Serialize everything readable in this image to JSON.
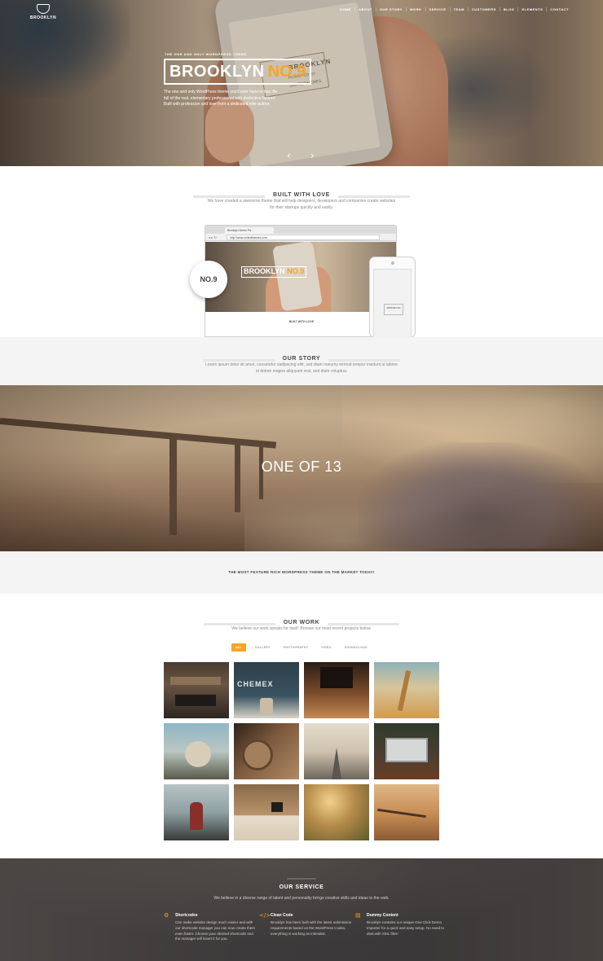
{
  "brand": {
    "name": "BROOKLYN"
  },
  "nav": {
    "items": [
      "HOME",
      "ABOUT",
      "OUR STORY",
      "WORK",
      "SERVICE",
      "TEAM",
      "CUSTOMERS",
      "BLOG",
      "ELEMENTS",
      "CONTACT"
    ]
  },
  "hero": {
    "kicker": "THE ONE AND ONLY WORDPRESS THEME",
    "title_a": "BROOKLYN",
    "title_b": "NO.9",
    "description": "The one and only WordPress theme you'll ever have to buy. Be full of the real, elementary professional with distinctive factors! Built with profession and love from a dedicated elite author.",
    "phone_brand": "BROOKLYN",
    "phone_powered": "POWERED BY",
    "phone_company": "UNITEDTHEMES",
    "prev_arrow": "‹",
    "next_arrow": "›"
  },
  "built": {
    "title": "BUILT WITH LOVE",
    "subtitle": "We have created a awesome theme that will help designers, developers and companies create websites for their startups quickly and easily.",
    "badge": "NO.9",
    "browser_tab": "Brooklyn Demo Pa...",
    "browser_url": "http://www.unitedthemes.com",
    "browser_title_a": "BROOKLYN",
    "browser_title_b": "NO.9",
    "browser_section": "BUILT WITH LOVE",
    "mobile_brand": "BROOKLYN"
  },
  "story": {
    "title": "OUR STORY",
    "subtitle": "Lorem ipsum dolor sit amet, consetetur sadipscing elitr, sed diam nonumy eirmod tempor invidunt ut labore et dolore magna aliquyam erat, sed diam voluptua."
  },
  "scene": {
    "title": "ONE OF 13"
  },
  "feature": {
    "text": "THE MOST FEATURE RICH WORDPRESS THEME ON THE MARKET TODAY!"
  },
  "work": {
    "title": "OUR WORK",
    "subtitle": "We believe our work speaks for itself. Browse our most recent projects below.",
    "filters": [
      "ALL",
      "GALLERY",
      "PHOTOGRAPHY",
      "VIDEO",
      "SOUNDCLOUD"
    ],
    "tiles": [
      {
        "name": "cafe-interior",
        "label": ""
      },
      {
        "name": "chemex-coffee",
        "label": "CHEMEX"
      },
      {
        "name": "wooden-floor",
        "label": ""
      },
      {
        "name": "wheat-field",
        "label": ""
      },
      {
        "name": "dog-on-bridge",
        "label": ""
      },
      {
        "name": "wood-logs",
        "label": ""
      },
      {
        "name": "misty-road",
        "label": ""
      },
      {
        "name": "laptop-desk",
        "label": ""
      },
      {
        "name": "hiker-waterfall",
        "label": ""
      },
      {
        "name": "camera-table",
        "label": ""
      },
      {
        "name": "sunset-grass",
        "label": ""
      },
      {
        "name": "fence-field",
        "label": ""
      }
    ]
  },
  "service": {
    "title": "OUR SERVICE",
    "subtitle": "We believe in a diverse range of talent and personality brings creative skills and ideas to the web.",
    "columns": [
      {
        "icon": "gear-icon",
        "glyph": "⚙",
        "heading": "Shortcodes",
        "text": "Can make website design much easier and with our shortcode manager you can now create them even faster. Choose your desired shortcode and the manager will insert it for you."
      },
      {
        "icon": "code-icon",
        "glyph": "</>",
        "heading": "Clean Code",
        "text": "Brooklyn has been built with the latest submission requirements based on the WordPress Codex, everything is working as intended."
      },
      {
        "icon": "document-icon",
        "glyph": "▤",
        "heading": "Dummy Content",
        "text": "Brooklyn contains our unique One Click Demo Importer for a quick and easy setup. No need to deal with XML files!"
      }
    ]
  },
  "colors": {
    "accent": "#f5a623",
    "dark_band": "#3c3a3a",
    "light_band": "#f4f4f4"
  }
}
